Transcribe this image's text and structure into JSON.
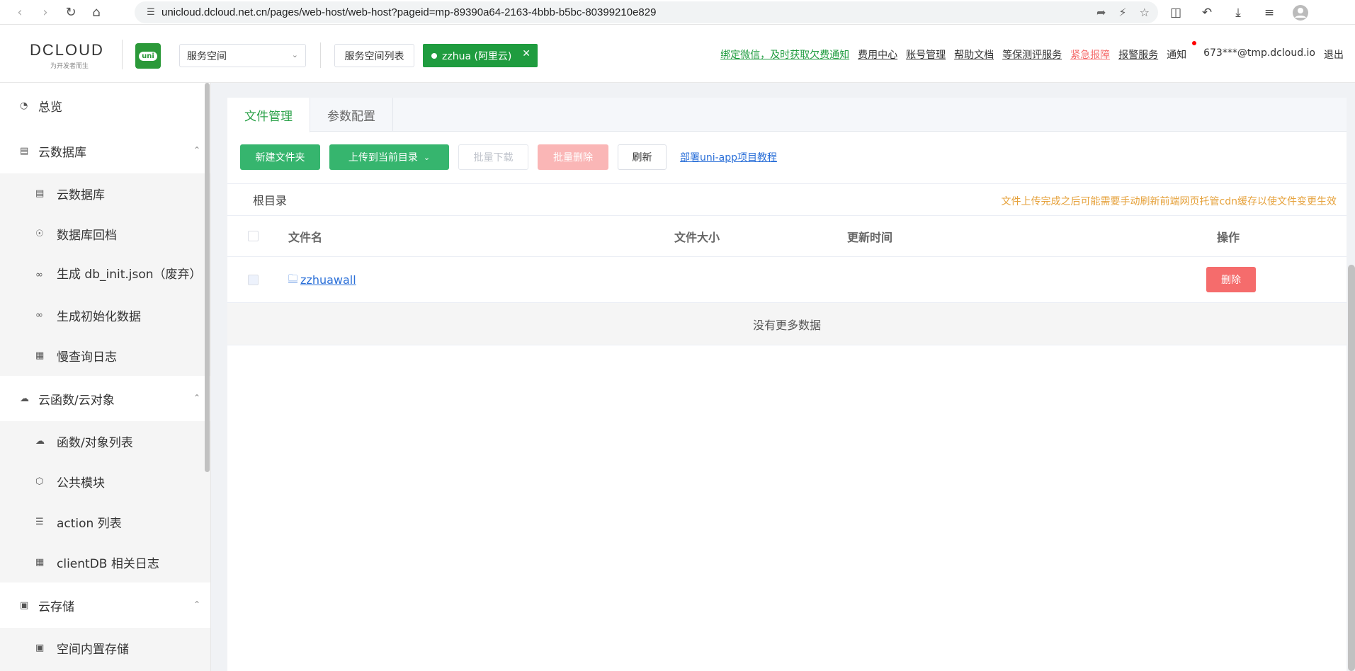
{
  "browser": {
    "url": "unicloud.dcloud.net.cn/pages/web-host/web-host?pageid=mp-89390a64-2163-4bbb-b5bc-80399210e829",
    "icons": [
      "back-icon",
      "forward-icon",
      "reload-icon",
      "home-icon",
      "site-info-icon",
      "share-icon",
      "lightning-icon",
      "star-icon",
      "extensions-icon",
      "undo-icon",
      "download-icon",
      "playlist-icon",
      "profile-icon"
    ]
  },
  "header": {
    "logo_text": "DCLOUD",
    "logo_tagline": "为开发者而生",
    "uni_badge": "uni",
    "space_select": "服务空间",
    "space_list_button": "服务空间列表",
    "active_space": "zzhua (阿里云)",
    "links": {
      "wechat": "绑定微信，及时获取欠费通知",
      "billing": "费用中心",
      "account": "账号管理",
      "help": "帮助文档",
      "security": "等保测评服务",
      "emergency": "紧急报障",
      "alarm": "报警服务",
      "notice": "通知",
      "user": "673***@tmp.dcloud.io",
      "logout": "退出"
    },
    "colors": {
      "brand_green": "#1f9c3f",
      "danger": "#f56c6c"
    }
  },
  "sidebar": {
    "overview": "总览",
    "db_group": "云数据库",
    "db_items": [
      "云数据库",
      "数据库回档",
      "生成 db_init.json（废弃）",
      "生成初始化数据",
      "慢查询日志"
    ],
    "func_group": "云函数/云对象",
    "func_items": [
      "函数/对象列表",
      "公共模块",
      "action 列表",
      "clientDB 相关日志"
    ],
    "storage_group": "云存储",
    "storage_items": [
      "空间内置存储"
    ]
  },
  "main": {
    "tabs": [
      "文件管理",
      "参数配置"
    ],
    "toolbar": {
      "new_folder": "新建文件夹",
      "upload": "上传到当前目录",
      "batch_download": "批量下载",
      "batch_delete": "批量删除",
      "refresh": "刷新",
      "tutorial": "部署uni-app项目教程"
    },
    "path_root": "根目录",
    "hint": "文件上传完成之后可能需要手动刷新前端网页托管cdn缓存以使文件变更生效",
    "columns": {
      "name": "文件名",
      "size": "文件大小",
      "updated": "更新时间",
      "action": "操作"
    },
    "rows": [
      {
        "name": "zzhuawall",
        "size": "",
        "updated": "",
        "action": "删除"
      }
    ],
    "empty_text": "没有更多数据"
  }
}
